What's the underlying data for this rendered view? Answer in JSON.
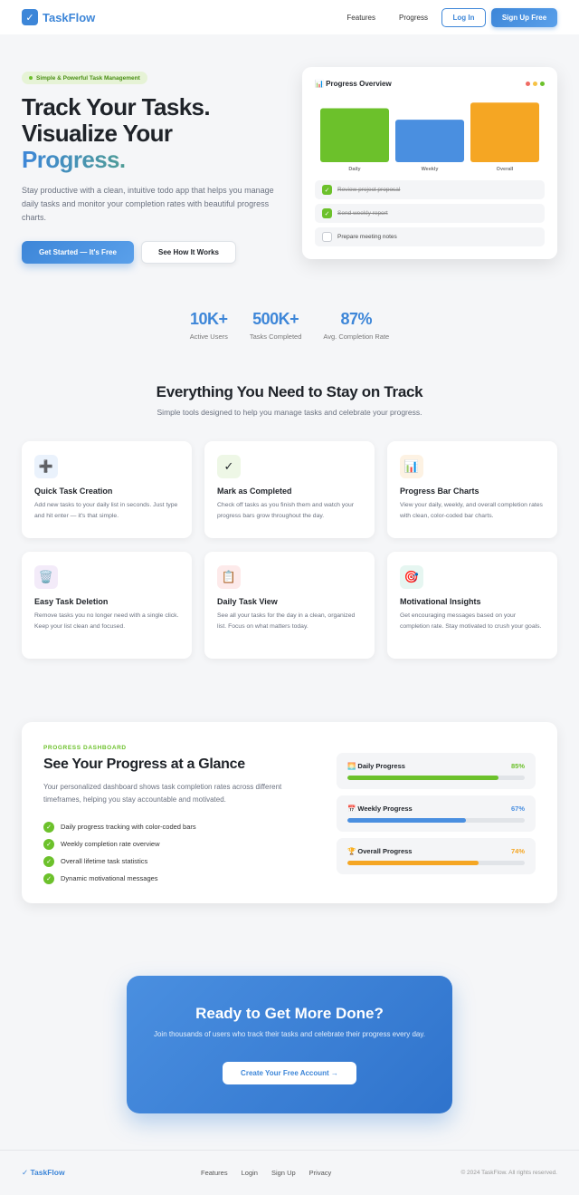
{
  "nav": {
    "logo_glyph": "✓",
    "logo_text": "TaskFlow",
    "links": [
      "Features",
      "Progress"
    ],
    "login_label": "Log In",
    "signup_label": "Sign Up Free"
  },
  "hero": {
    "badge": "Simple & Powerful Task Management",
    "title_line1": "Track Your Tasks.",
    "title_line2": "Visualize Your",
    "title_line3": "Progress.",
    "description": "Stay productive with a clean, intuitive todo app that helps you manage daily tasks and monitor your completion rates with beautiful progress charts.",
    "primary_cta": "Get Started — It's Free",
    "secondary_cta": "See How It Works"
  },
  "overview_card": {
    "title": "📊 Progress Overview",
    "dot_colors": [
      "#ef6b63",
      "#f6c245",
      "#6cc12b"
    ],
    "tasks": [
      {
        "label": "Review project proposal",
        "done": true
      },
      {
        "label": "Send weekly report",
        "done": true
      },
      {
        "label": "Prepare meeting notes",
        "done": false
      }
    ]
  },
  "chart_data": {
    "type": "bar",
    "categories": [
      "Daily",
      "Weekly",
      "Overall"
    ],
    "values": [
      85,
      67,
      94
    ],
    "colors": [
      "#6cc12b",
      "#4a8fe0",
      "#f5a623"
    ],
    "ylim": [
      0,
      100
    ],
    "title": "",
    "xlabel": "",
    "ylabel": ""
  },
  "stats": [
    {
      "value": "10K+",
      "label": "Active Users"
    },
    {
      "value": "500K+",
      "label": "Tasks Completed"
    },
    {
      "value": "87%",
      "label": "Avg. Completion Rate"
    }
  ],
  "features": {
    "title": "Everything You Need to Stay on Track",
    "subtitle": "Simple tools designed to help you manage tasks and celebrate your progress.",
    "items": [
      {
        "icon": "➕",
        "icon_name": "plus-icon",
        "bg": "#eaf2fc",
        "title": "Quick Task Creation",
        "desc": "Add new tasks to your daily list in seconds. Just type and hit enter — it's that simple."
      },
      {
        "icon": "✓",
        "icon_name": "check-icon",
        "bg": "#eef7e6",
        "title": "Mark as Completed",
        "desc": "Check off tasks as you finish them and watch your progress bars grow throughout the day."
      },
      {
        "icon": "📊",
        "icon_name": "bar-chart-icon",
        "bg": "#fdf2e3",
        "title": "Progress Bar Charts",
        "desc": "View your daily, weekly, and overall completion rates with clean, color-coded bar charts."
      },
      {
        "icon": "🗑️",
        "icon_name": "trash-icon",
        "bg": "#f3ebf9",
        "title": "Easy Task Deletion",
        "desc": "Remove tasks you no longer need with a single click. Keep your list clean and focused."
      },
      {
        "icon": "📋",
        "icon_name": "clipboard-icon",
        "bg": "#fdeaea",
        "title": "Daily Task View",
        "desc": "See all your tasks for the day in a clean, organized list. Focus on what matters today."
      },
      {
        "icon": "🎯",
        "icon_name": "target-icon",
        "bg": "#e6f6f1",
        "title": "Motivational Insights",
        "desc": "Get encouraging messages based on your completion rate. Stay motivated to crush your goals."
      }
    ]
  },
  "dashboard": {
    "kicker": "PROGRESS DASHBOARD",
    "title": "See Your Progress at a Glance",
    "description": "Your personalized dashboard shows task completion rates across different timeframes, helping you stay accountable and motivated.",
    "checklist": [
      "Daily progress tracking with color-coded bars",
      "Weekly completion rate overview",
      "Overall lifetime task statistics",
      "Dynamic motivational messages"
    ],
    "progress": [
      {
        "label": "🌅 Daily Progress",
        "percent_text": "85%",
        "value": 85,
        "color": "#6cc12b"
      },
      {
        "label": "📅 Weekly Progress",
        "percent_text": "67%",
        "value": 67,
        "color": "#4a8fe0"
      },
      {
        "label": "🏆 Overall Progress",
        "percent_text": "74%",
        "value": 74,
        "color": "#f5a623"
      }
    ]
  },
  "cta": {
    "title": "Ready to Get More Done?",
    "description": "Join thousands of users who track their tasks and celebrate their progress every day.",
    "button": "Create Your Free Account →"
  },
  "footer": {
    "logo": "✓ TaskFlow",
    "links": [
      "Features",
      "Login",
      "Sign Up",
      "Privacy"
    ],
    "copyright": "© 2024 TaskFlow. All rights reserved."
  }
}
